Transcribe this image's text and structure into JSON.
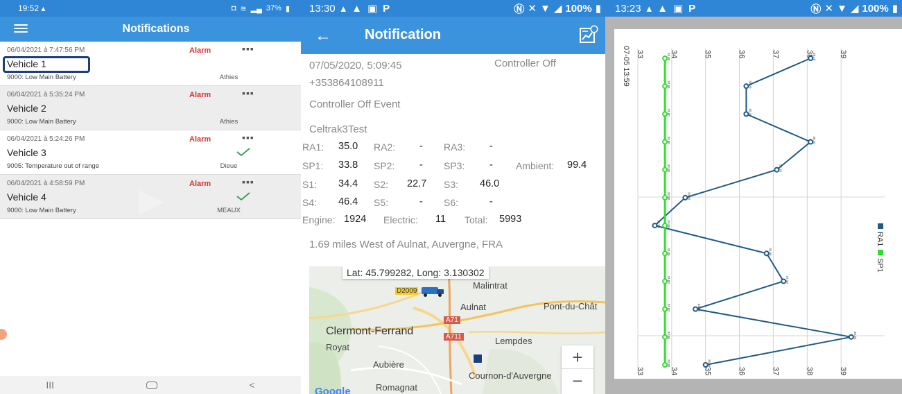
{
  "screen1": {
    "status": {
      "time": "19:52",
      "battery": "37%"
    },
    "title": "Notifications",
    "rows": [
      {
        "date": "06/04/2021 à 7:47:56 PM",
        "alarm": "Alarm",
        "vehicle": "Vehicle 1",
        "desc": "9000: Low Main Battery",
        "place": "Athies",
        "acknowledged": false
      },
      {
        "date": "06/04/2021 à 5:35:24 PM",
        "alarm": "Alarm",
        "vehicle": "Vehicle 2",
        "desc": "9000: Low Main Battery",
        "place": "Athies",
        "acknowledged": false
      },
      {
        "date": "06/04/2021 à 5:24:26 PM",
        "alarm": "Alarm",
        "vehicle": "Vehicle 3",
        "desc": "9005: Temperature out of range",
        "place": "Dieue",
        "acknowledged": true
      },
      {
        "date": "06/04/2021 à 4:58:59 PM",
        "alarm": "Alarm",
        "vehicle": "Vehicle 4",
        "desc": "9000: Low Main Battery",
        "place": "MEAUX",
        "acknowledged": true
      }
    ],
    "nav": {
      "recent": "III",
      "home": "○",
      "back": "<"
    },
    "colors": {
      "header": "#3b93de",
      "alarm": "#d92c2c",
      "check": "#2e9e4e"
    }
  },
  "screen2": {
    "status": {
      "time": "13:30",
      "battery": "100%"
    },
    "title": "Notification",
    "back": "←",
    "datetime": "07/05/2020, 5:09:45",
    "event_short": "Controller Off",
    "phone": "+353864108911",
    "event": "Controller Off Event",
    "unit": "Celtrak3Test",
    "readings": {
      "ra1_label": "RA1:",
      "ra1": "35.0",
      "ra2_label": "RA2:",
      "ra2": "-",
      "ra3_label": "RA3:",
      "ra3": "-",
      "sp1_label": "SP1:",
      "sp1": "33.8",
      "sp2_label": "SP2:",
      "sp2": "-",
      "sp3_label": "SP3:",
      "sp3": "-",
      "ambient_label": "Ambient:",
      "ambient": "99.4",
      "s1_label": "S1:",
      "s1": "34.4",
      "s2_label": "S2:",
      "s2": "22.7",
      "s3_label": "S3:",
      "s3": "46.0",
      "s4_label": "S4:",
      "s4": "46.4",
      "s5_label": "S5:",
      "s5": "-",
      "s6_label": "S6:",
      "s6": "-",
      "engine_label": "Engine:",
      "engine": "1924",
      "electric_label": "Electric:",
      "electric": "11",
      "total_label": "Total:",
      "total": "5993"
    },
    "location": "1.69 miles West of Aulnat, Auvergne, FRA",
    "map": {
      "tooltip": "Lat: 45.799282, Long: 3.130302",
      "labels": {
        "d2009": "D2009",
        "malintrat": "Malintrat",
        "aulnat": "Aulnat",
        "pont": "Pont-du-Chât",
        "a71": "A71",
        "a711": "A711",
        "clermont": "Clermont-Ferrand",
        "lempdes": "Lempdes",
        "royat": "Royat",
        "aubiere": "Aubière",
        "cournon": "Cournon-d'Auvergne",
        "romagnat": "Romagnat",
        "google": "Google"
      },
      "zoom_in": "+",
      "zoom_out": "−"
    }
  },
  "screen3": {
    "status": {
      "time": "13:23",
      "battery": "100%"
    },
    "chart_data": {
      "type": "line",
      "orientation": "rotated-90",
      "x_label_start": "07-05 13:59",
      "ylim": [
        33,
        40
      ],
      "ticks": [
        "33",
        "34",
        "35",
        "36",
        "37",
        "38",
        "39"
      ],
      "series": [
        {
          "name": "RA1",
          "color": "#1f5b85",
          "values": [
            38.1,
            36.2,
            36.2,
            38.1,
            37.1,
            34.4,
            33.5,
            36.8,
            37.3,
            34.7,
            39.3,
            35.0
          ],
          "point_labels": [
            "38.10",
            "36.20",
            "36.20",
            "38.10",
            "37.10",
            "34.40",
            "33.50",
            "36.80",
            "37.30",
            "34.70",
            "39.30",
            "35.00"
          ]
        },
        {
          "name": "SP1",
          "color": "#2ee02e",
          "values": [
            33.8,
            33.8,
            33.8,
            33.8,
            33.8,
            33.8,
            33.8,
            33.8,
            33.8,
            33.8,
            33.8,
            33.8
          ],
          "point_labels": [
            "33.80",
            "33.80",
            "33.80",
            "33.80",
            "33.80",
            "33.80",
            "33.80",
            "33.80",
            "33.80",
            "33.80",
            "33.80",
            "33.80"
          ]
        }
      ],
      "legend_position": "right",
      "grid": true
    }
  }
}
